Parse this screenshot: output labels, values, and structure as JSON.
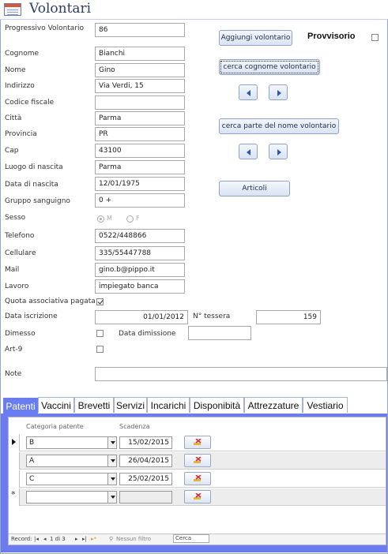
{
  "form": {
    "title": "Volontari"
  },
  "fields": {
    "progressivo": {
      "label": "Progressivo Volontario",
      "value": "86"
    },
    "cognome": {
      "label": "Cognome",
      "value": "Bianchi"
    },
    "nome": {
      "label": "Nome",
      "value": "Gino"
    },
    "indirizzo": {
      "label": "Indirizzo",
      "value": "Via Verdi, 15"
    },
    "codice_fiscale": {
      "label": "Codice fiscale",
      "value": ""
    },
    "citta": {
      "label": "Città",
      "value": "Parma"
    },
    "provincia": {
      "label": "Provincia",
      "value": "PR"
    },
    "cap": {
      "label": "Cap",
      "value": "43100"
    },
    "luogo_nascita": {
      "label": "Luogo di nascita",
      "value": "Parma"
    },
    "data_nascita": {
      "label": "Data di nascita",
      "value": "12/01/1975"
    },
    "gruppo_sanguigno": {
      "label": "Gruppo sanguigno",
      "value": "0 +"
    },
    "sesso": {
      "label": "Sesso",
      "option_m": "M",
      "option_f": "F",
      "selected": "M"
    },
    "telefono": {
      "label": "Telefono",
      "value": "0522/448866"
    },
    "cellulare": {
      "label": "Cellulare",
      "value": "335/55447788"
    },
    "mail": {
      "label": "Mail",
      "value": "gino.b@pippo.it"
    },
    "lavoro": {
      "label": "Lavoro",
      "value": "impiegato banca"
    },
    "quota": {
      "label": "Quota associativa pagata",
      "checked": true
    },
    "data_iscrizione": {
      "label": "Data iscrizione",
      "value": "01/01/2012"
    },
    "n_tessera": {
      "label": "N° tessera",
      "value": "159"
    },
    "dimesso": {
      "label": "Dimesso",
      "checked": false
    },
    "data_dimissione": {
      "label": "Data dimissione",
      "value": ""
    },
    "art9": {
      "label": "Art-9",
      "checked": false
    },
    "note": {
      "label": "Note",
      "value": ""
    }
  },
  "buttons": {
    "aggiungi": "Aggiungi volontario",
    "provvisorio": "Provvisorio",
    "cerca_cognome": "cerca cognome volontario",
    "cerca_parte": "cerca parte del nome volontario",
    "articoli": "Articoli"
  },
  "tabs": [
    "Patenti",
    "Vaccini",
    "Brevetti",
    "Servizi",
    "Incarichi",
    "Disponibità",
    "Attrezzature",
    "Vestiario"
  ],
  "active_tab": "Patenti",
  "subform": {
    "col_categoria": "Categoria patente",
    "col_scadenza": "Scadenza",
    "rows": [
      {
        "categoria": "B",
        "scadenza": "15/02/2015"
      },
      {
        "categoria": "A",
        "scadenza": "26/04/2015"
      },
      {
        "categoria": "C",
        "scadenza": "25/02/2015"
      }
    ],
    "new_row_marker": "*"
  },
  "record_nav": {
    "record_label": "Record:",
    "position": "1 di 3",
    "filter": "Nessun filtro",
    "search": "Cerca"
  },
  "colors": {
    "tab_active": "#6a7df0",
    "subform_bg": "#6c7cee",
    "nav_arrow": "#2b58b5"
  }
}
